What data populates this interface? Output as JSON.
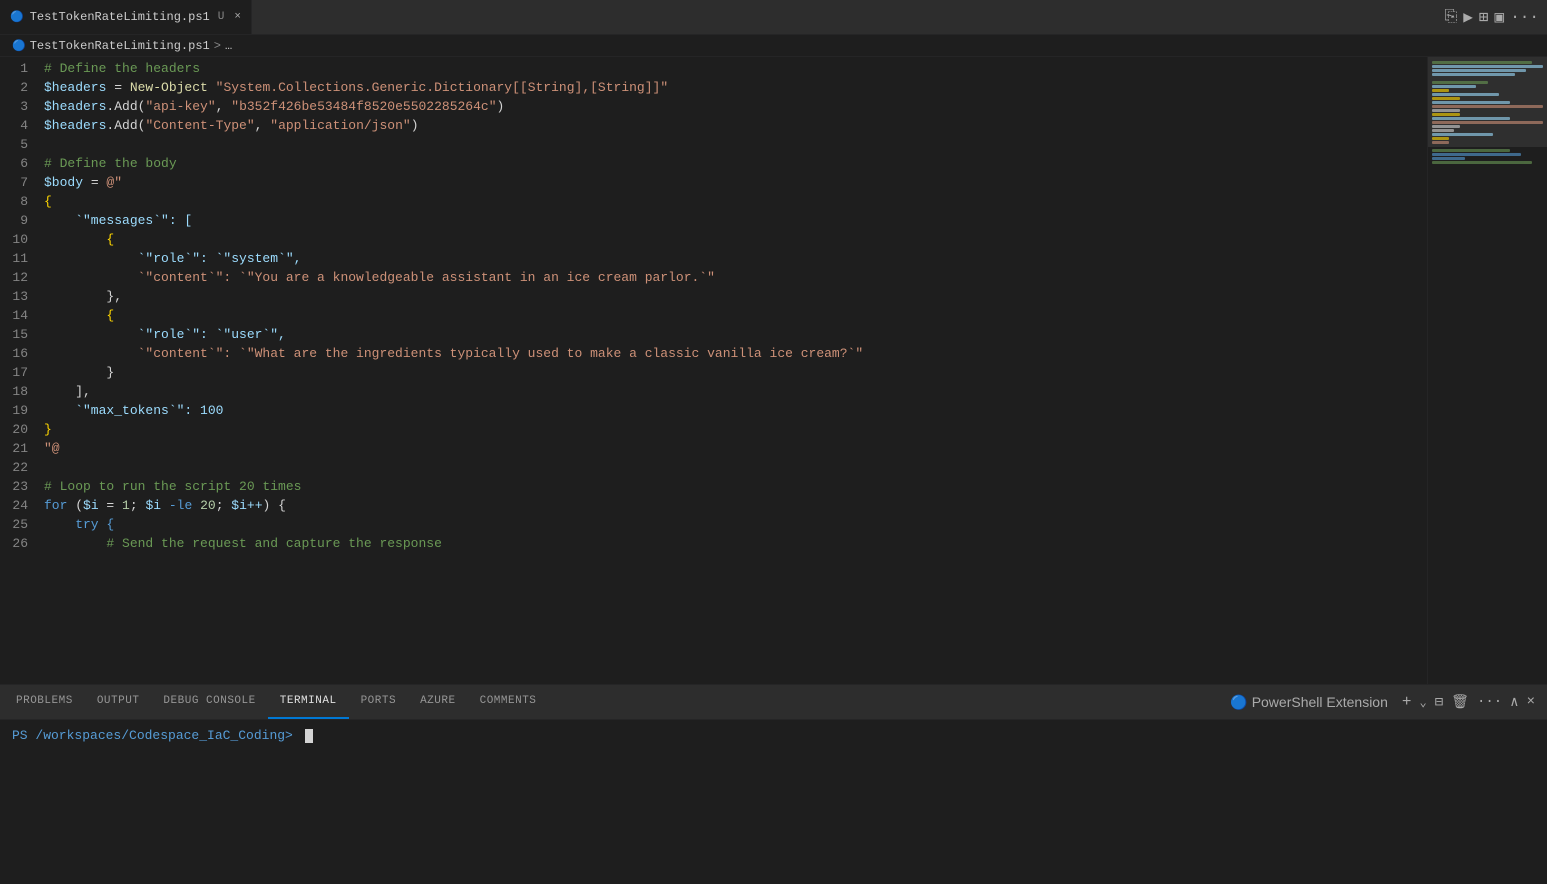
{
  "tab": {
    "icon": "🔵",
    "filename": "TestTokenRateLimiting.ps1",
    "modified_indicator": "U",
    "close_label": "×"
  },
  "tab_actions": {
    "split": "⎘",
    "run": "▶",
    "split_editor": "⊞",
    "layout": "▣",
    "more": "···"
  },
  "breadcrumb": {
    "icon": "🔵",
    "filename": "TestTokenRateLimiting.ps1",
    "separator": ">",
    "more": "…"
  },
  "code_lines": [
    {
      "num": 1,
      "tokens": [
        {
          "text": "# Define the headers",
          "cls": "c-comment"
        }
      ]
    },
    {
      "num": 2,
      "tokens": [
        {
          "text": "$headers",
          "cls": "c-variable"
        },
        {
          "text": " = ",
          "cls": "c-operator"
        },
        {
          "text": "New-Object",
          "cls": "c-cmdlet"
        },
        {
          "text": " ",
          "cls": "c-plain"
        },
        {
          "text": "\"System.Collections.Generic.Dictionary[[String],[String]]\"",
          "cls": "c-string"
        }
      ]
    },
    {
      "num": 3,
      "tokens": [
        {
          "text": "$headers",
          "cls": "c-variable"
        },
        {
          "text": ".Add(",
          "cls": "c-plain"
        },
        {
          "text": "\"api-key\"",
          "cls": "c-string"
        },
        {
          "text": ", ",
          "cls": "c-plain"
        },
        {
          "text": "\"b352f426be53484f8520e5502285264c\"",
          "cls": "c-string"
        },
        {
          "text": ")",
          "cls": "c-plain"
        }
      ]
    },
    {
      "num": 4,
      "tokens": [
        {
          "text": "$headers",
          "cls": "c-variable"
        },
        {
          "text": ".Add(",
          "cls": "c-plain"
        },
        {
          "text": "\"Content-Type\"",
          "cls": "c-string"
        },
        {
          "text": ", ",
          "cls": "c-plain"
        },
        {
          "text": "\"application/json\"",
          "cls": "c-string"
        },
        {
          "text": ")",
          "cls": "c-plain"
        }
      ]
    },
    {
      "num": 5,
      "tokens": []
    },
    {
      "num": 6,
      "tokens": [
        {
          "text": "# Define the body",
          "cls": "c-comment"
        }
      ]
    },
    {
      "num": 7,
      "tokens": [
        {
          "text": "$body",
          "cls": "c-variable"
        },
        {
          "text": " = ",
          "cls": "c-operator"
        },
        {
          "text": "@\"",
          "cls": "c-string"
        }
      ]
    },
    {
      "num": 8,
      "tokens": [
        {
          "text": "{",
          "cls": "c-bracket"
        }
      ]
    },
    {
      "num": 9,
      "tokens": [
        {
          "text": "    `\"messages`\": [",
          "cls": "c-json-key"
        }
      ]
    },
    {
      "num": 10,
      "tokens": [
        {
          "text": "        {",
          "cls": "c-bracket"
        }
      ]
    },
    {
      "num": 11,
      "tokens": [
        {
          "text": "            `\"role`\": `\"system`\",",
          "cls": "c-json-key"
        }
      ]
    },
    {
      "num": 12,
      "tokens": [
        {
          "text": "            `\"content`\": `\"You are a knowledgeable assistant in an ice cream parlor.`\"",
          "cls": "c-string"
        }
      ]
    },
    {
      "num": 13,
      "tokens": [
        {
          "text": "        },",
          "cls": "c-plain"
        }
      ]
    },
    {
      "num": 14,
      "tokens": [
        {
          "text": "        {",
          "cls": "c-bracket"
        }
      ]
    },
    {
      "num": 15,
      "tokens": [
        {
          "text": "            `\"role`\": `\"user`\",",
          "cls": "c-json-key"
        }
      ]
    },
    {
      "num": 16,
      "tokens": [
        {
          "text": "            `\"content`\": `\"What are the ingredients typically used to make a classic vanilla ice cream?`\"",
          "cls": "c-string"
        }
      ]
    },
    {
      "num": 17,
      "tokens": [
        {
          "text": "        }",
          "cls": "c-plain"
        }
      ]
    },
    {
      "num": 18,
      "tokens": [
        {
          "text": "    ],",
          "cls": "c-plain"
        }
      ]
    },
    {
      "num": 19,
      "tokens": [
        {
          "text": "    `\"max_tokens`\": 100",
          "cls": "c-json-key"
        }
      ]
    },
    {
      "num": 20,
      "tokens": [
        {
          "text": "}",
          "cls": "c-bracket"
        }
      ]
    },
    {
      "num": 21,
      "tokens": [
        {
          "text": "\"@",
          "cls": "c-string"
        }
      ]
    },
    {
      "num": 22,
      "tokens": []
    },
    {
      "num": 23,
      "tokens": [
        {
          "text": "# Loop to run the script 20 times",
          "cls": "c-comment"
        }
      ]
    },
    {
      "num": 24,
      "tokens": [
        {
          "text": "for",
          "cls": "c-keyword"
        },
        {
          "text": " (",
          "cls": "c-plain"
        },
        {
          "text": "$i",
          "cls": "c-variable"
        },
        {
          "text": " = ",
          "cls": "c-operator"
        },
        {
          "text": "1",
          "cls": "c-number"
        },
        {
          "text": "; ",
          "cls": "c-plain"
        },
        {
          "text": "$i",
          "cls": "c-variable"
        },
        {
          "text": " -le ",
          "cls": "c-keyword"
        },
        {
          "text": "20",
          "cls": "c-number"
        },
        {
          "text": "; ",
          "cls": "c-plain"
        },
        {
          "text": "$i++",
          "cls": "c-variable"
        },
        {
          "text": ") {",
          "cls": "c-plain"
        }
      ]
    },
    {
      "num": 25,
      "tokens": [
        {
          "text": "    try {",
          "cls": "c-keyword"
        }
      ]
    },
    {
      "num": 26,
      "tokens": [
        {
          "text": "        # Send the request and capture the response",
          "cls": "c-comment"
        }
      ]
    }
  ],
  "panel": {
    "tabs": [
      {
        "label": "PROBLEMS",
        "active": false
      },
      {
        "label": "OUTPUT",
        "active": false
      },
      {
        "label": "DEBUG CONSOLE",
        "active": false
      },
      {
        "label": "TERMINAL",
        "active": true
      },
      {
        "label": "PORTS",
        "active": false
      },
      {
        "label": "AZURE",
        "active": false
      },
      {
        "label": "COMMENTS",
        "active": false
      }
    ],
    "ps_extension_label": "PowerShell Extension",
    "add_label": "+",
    "split_label": "⊟",
    "delete_label": "🗑",
    "more_label": "···",
    "chevron_up": "∧",
    "close_label": "×"
  },
  "terminal": {
    "prompt_prefix": ">",
    "cwd": "PS /workspaces/Codespace_IaC_Coding>"
  }
}
